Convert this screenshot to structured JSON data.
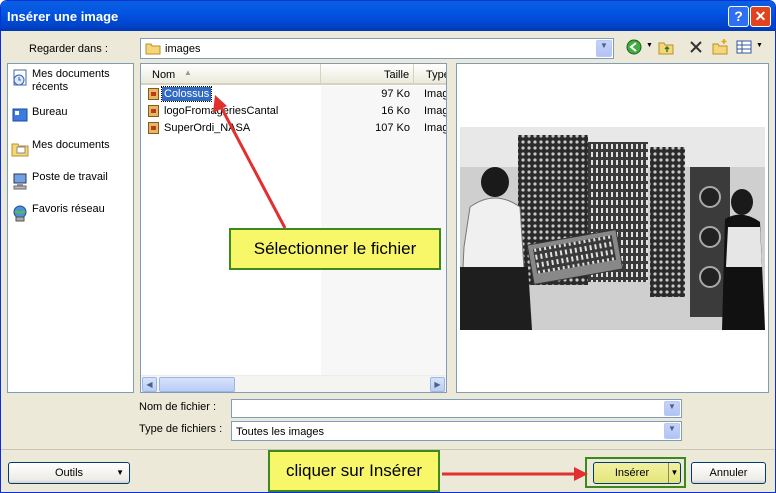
{
  "window": {
    "title": "Insérer une image"
  },
  "title_buttons": {
    "help": "?",
    "close": "✕"
  },
  "look_in": {
    "label": "Regarder dans :",
    "value": "images"
  },
  "places": [
    {
      "label": "Mes documents récents",
      "icon": "recent-documents-icon"
    },
    {
      "label": "Bureau",
      "icon": "desktop-icon"
    },
    {
      "label": "Mes documents",
      "icon": "my-documents-icon"
    },
    {
      "label": "Poste de travail",
      "icon": "my-computer-icon"
    },
    {
      "label": "Favoris réseau",
      "icon": "network-places-icon"
    }
  ],
  "file_list": {
    "columns": {
      "name": "Nom",
      "size": "Taille",
      "type": "Type"
    },
    "rows": [
      {
        "name": "Colossus",
        "size": "97 Ko",
        "type": "Imag",
        "selected": true
      },
      {
        "name": "logoFromageriesCantal",
        "size": "16 Ko",
        "type": "Imag",
        "selected": false
      },
      {
        "name": "SuperOrdi_NASA",
        "size": "107 Ko",
        "type": "Imag",
        "selected": false
      }
    ]
  },
  "filename": {
    "label": "Nom de fichier :",
    "value": ""
  },
  "filetype": {
    "label": "Type de fichiers :",
    "value": "Toutes les images"
  },
  "buttons": {
    "tools": "Outils",
    "insert": "Insérer",
    "cancel": "Annuler"
  },
  "annotations": {
    "select_file": "Sélectionner le fichier",
    "click_insert": "cliquer sur Insérer"
  },
  "colors": {
    "titlebar": "#0255e3",
    "selection": "#316ac5",
    "callout_fill": "#f7f769",
    "callout_border": "#3c8a1d",
    "arrow": "#e03030"
  }
}
